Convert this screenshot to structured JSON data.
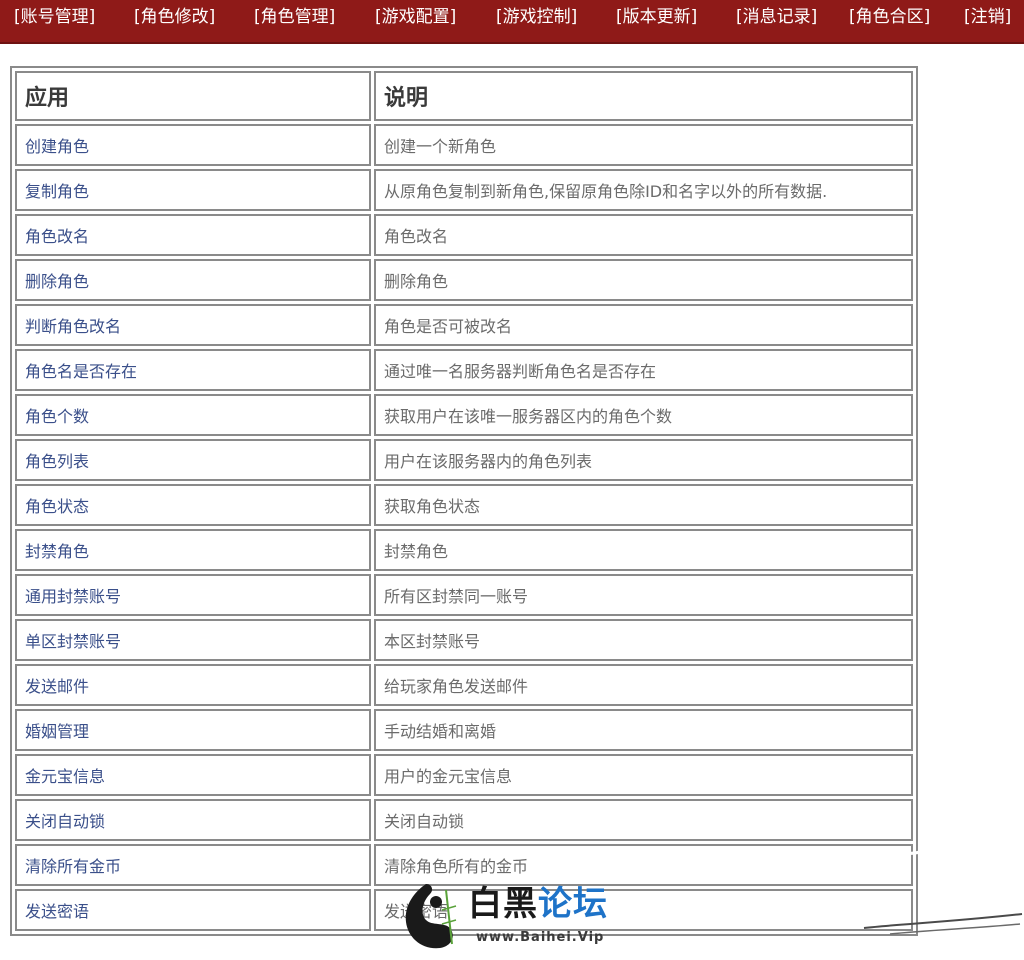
{
  "nav": {
    "items": [
      {
        "label": "[账号管理]"
      },
      {
        "label": "[角色修改]"
      },
      {
        "label": "[角色管理]"
      },
      {
        "label": "[游戏配置]"
      },
      {
        "label": "[游戏控制]"
      },
      {
        "label": "[版本更新]"
      },
      {
        "label": "[消息记录]"
      },
      {
        "label": "[角色合区]"
      },
      {
        "label": "[注销]"
      }
    ]
  },
  "table": {
    "headers": {
      "app": "应用",
      "desc": "说明"
    },
    "rows": [
      {
        "app": "创建角色",
        "desc": "创建一个新角色"
      },
      {
        "app": "复制角色",
        "desc": "从原角色复制到新角色,保留原角色除ID和名字以外的所有数据."
      },
      {
        "app": "角色改名",
        "desc": "角色改名"
      },
      {
        "app": "删除角色",
        "desc": "删除角色"
      },
      {
        "app": "判断角色改名",
        "desc": "角色是否可被改名"
      },
      {
        "app": "角色名是否存在",
        "desc": "通过唯一名服务器判断角色名是否存在"
      },
      {
        "app": "角色个数",
        "desc": "获取用户在该唯一服务器区内的角色个数"
      },
      {
        "app": "角色列表",
        "desc": "用户在该服务器内的角色列表"
      },
      {
        "app": "角色状态",
        "desc": "获取角色状态"
      },
      {
        "app": "封禁角色",
        "desc": "封禁角色"
      },
      {
        "app": "通用封禁账号",
        "desc": "所有区封禁同一账号"
      },
      {
        "app": "单区封禁账号",
        "desc": "本区封禁账号"
      },
      {
        "app": "发送邮件",
        "desc": "给玩家角色发送邮件"
      },
      {
        "app": "婚姻管理",
        "desc": "手动结婚和离婚"
      },
      {
        "app": "金元宝信息",
        "desc": "用户的金元宝信息"
      },
      {
        "app": "关闭自动锁",
        "desc": "关闭自动锁"
      },
      {
        "app": "清除所有金币",
        "desc": "清除角色所有的金币"
      },
      {
        "app": "发送密语",
        "desc": "发送密语"
      }
    ]
  },
  "watermark": {
    "title_part1": "白黑",
    "title_part2": "论坛",
    "url": "www.Baihei.Vip"
  },
  "colors": {
    "nav_bg": "#8f1a18",
    "link": "#3a4f8a",
    "desc_text": "#6b6b6b",
    "border": "#8a8a8a"
  }
}
